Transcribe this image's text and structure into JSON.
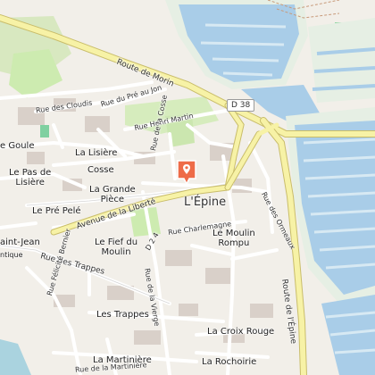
{
  "map": {
    "town": "L'Épine",
    "place_labels": {
      "goule": "e Goule",
      "pas_de_lisiere": "Le Pas de\nLisière",
      "lisiere": "La Lisière",
      "cosse": "Cosse",
      "grande_piece": "La Grande\nPièce",
      "pre_pele": "Le Pré Pelé",
      "saint_jean": "aint-Jean",
      "fief_du_moulin": "Le Fief du\nMoulin",
      "moulin_rompu": "Le Moulin\nRompu",
      "trappes": "Les Trappes",
      "croix_rouge": "La Croix Rouge",
      "martiniere": "La Martinière",
      "rochoirie": "La Rochoirie",
      "antique": "ntique"
    },
    "road_labels": {
      "route_de_morin": "Route de Morin",
      "pre_au_jon": "Rue du Pré au Jon",
      "cloudis": "Rue des Cloudis",
      "henri_martin": "Rue Henri Martin",
      "la_cosse": "Rue de la Cosse",
      "avenue_liberte": "Avenue de la Liberté",
      "charlemagne": "Rue Charlemagne",
      "d_2_4": "D 2 4",
      "la_vierge": "Rue de la Vierge",
      "ormeaux": "Rue des Ormeaux",
      "route_de_lepine": "Route de l'Épine",
      "rue_des_trappes": "Rue des Trappes",
      "felicite_bernier": "Rue Félicité Bernier",
      "la_martiniere": "Rue de la Martinière"
    },
    "road_shield": "D 38",
    "marker_icon": "map-pin-icon",
    "colors": {
      "land": "#f2efe9",
      "salt_marsh": "#a9cde8",
      "water": "#aad3df",
      "primary_road": "#f7f2a6",
      "minor_road": "#ffffff",
      "grass": "#cdebb0",
      "marker": "#ee6b48"
    }
  }
}
